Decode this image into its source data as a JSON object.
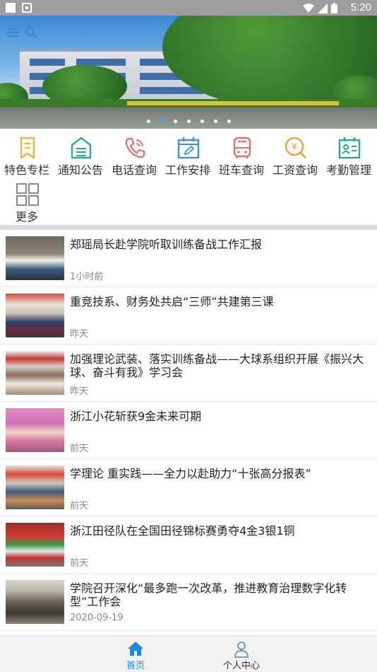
{
  "status_bar": {
    "time": "5:20"
  },
  "colors": {
    "accent": "#29b6f6",
    "tab_active": "#1e88e5",
    "tab_inactive": "#6d8fb0"
  },
  "quick_menu": [
    {
      "label": "特色专栏",
      "icon": "bookmark-icon",
      "color": "#f2b233"
    },
    {
      "label": "通知公告",
      "icon": "announcement-icon",
      "color": "#27a9a0"
    },
    {
      "label": "电话查询",
      "icon": "phone-icon",
      "color": "#ef6a6a"
    },
    {
      "label": "工作安排",
      "icon": "calendar-edit-icon",
      "color": "#3f8fd8"
    },
    {
      "label": "班车查询",
      "icon": "bus-icon",
      "color": "#ef6a6a"
    },
    {
      "label": "工资查询",
      "icon": "salary-search-icon",
      "color": "#f0a03a"
    },
    {
      "label": "考勤管理",
      "icon": "attendance-icon",
      "color": "#27a98a"
    },
    {
      "label": "更多",
      "icon": "grid-more-icon",
      "color": "#8a8a8a"
    }
  ],
  "news": [
    {
      "title": "郑瑶局长赴学院听取训练备战工作汇报",
      "time": "1小时前",
      "thumb": "meeting-speaker"
    },
    {
      "title": "重竞技系、财务处共启“三师”共建第三课",
      "time": "昨天",
      "thumb": "group-photo"
    },
    {
      "title": "加强理论武装、落实训练备战——大球系组织开展《振兴大球、奋斗有我》学习会",
      "time": "昨天",
      "thumb": "study-meeting"
    },
    {
      "title": "浙江小花斩获9金未来可期",
      "time": "前天",
      "thumb": "gymnasts"
    },
    {
      "title": "学理论 重实践——全力以赴助力“十张高分报表”",
      "time": "前天",
      "thumb": "classroom"
    },
    {
      "title": "浙江田径队在全国田径锦标赛勇夺4金3银1铜",
      "time": "前天",
      "thumb": "athletes"
    },
    {
      "title": "学院召开深化“最多跑一次改革，推进教育治理数字化转型”工作会",
      "time": "2020-09-19",
      "thumb": "conference"
    }
  ],
  "bottom_nav": [
    {
      "label": "首页",
      "icon": "home-icon",
      "active": true
    },
    {
      "label": "个人中心",
      "icon": "person-icon",
      "active": false
    }
  ]
}
